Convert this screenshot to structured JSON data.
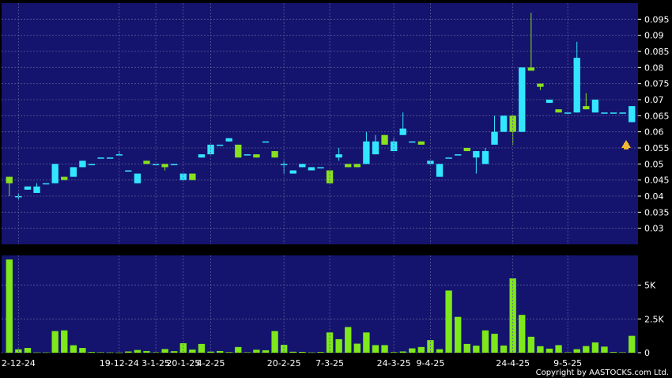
{
  "colors": {
    "background": "#000000",
    "panel": "#14146e",
    "grid": "#5a5a9a",
    "up": "#33e6ff",
    "down": "#88e01e",
    "volume": "#7ee81a",
    "text": "#ffffff",
    "arrow": "#f5b731"
  },
  "copyright": "Copyright by AASTOCKS.com Ltd.",
  "chart_data": [
    {
      "type": "candlestick",
      "y_range": [
        0.025,
        0.1
      ],
      "y_ticks": [
        "0.095",
        "0.09",
        "0.085",
        "0.08",
        "0.075",
        "0.07",
        "0.065",
        "0.06",
        "0.055",
        "0.05",
        "0.045",
        "0.04",
        "0.035",
        "0.03"
      ],
      "tick_values": [
        0.095,
        0.09,
        0.085,
        0.08,
        0.075,
        0.07,
        0.065,
        0.06,
        0.055,
        0.05,
        0.045,
        0.04,
        0.035,
        0.03
      ],
      "grid": true,
      "ohlc": [
        [
          0.046,
          0.046,
          0.04,
          0.044
        ],
        [
          0.04,
          0.041,
          0.039,
          0.04
        ],
        [
          0.042,
          0.043,
          0.042,
          0.043
        ],
        [
          0.041,
          0.044,
          0.041,
          0.043
        ],
        [
          0.044,
          0.044,
          0.044,
          0.044
        ],
        [
          0.044,
          0.05,
          0.044,
          0.05
        ],
        [
          0.046,
          0.046,
          0.045,
          0.045
        ],
        [
          0.046,
          0.049,
          0.046,
          0.049
        ],
        [
          0.049,
          0.051,
          0.049,
          0.051
        ],
        [
          0.05,
          0.05,
          0.05,
          0.05
        ],
        [
          0.052,
          0.052,
          0.052,
          0.052
        ],
        [
          0.052,
          0.052,
          0.052,
          0.052
        ],
        [
          0.053,
          0.054,
          0.053,
          0.053
        ],
        [
          0.048,
          0.048,
          0.048,
          0.048
        ],
        [
          0.044,
          0.047,
          0.044,
          0.047
        ],
        [
          0.051,
          0.051,
          0.05,
          0.05
        ],
        [
          0.05,
          0.05,
          0.05,
          0.05
        ],
        [
          0.05,
          0.05,
          0.048,
          0.049
        ],
        [
          0.05,
          0.05,
          0.05,
          0.05
        ],
        [
          0.045,
          0.047,
          0.045,
          0.047
        ],
        [
          0.047,
          0.047,
          0.045,
          0.045
        ],
        [
          0.052,
          0.053,
          0.052,
          0.053
        ],
        [
          0.053,
          0.056,
          0.053,
          0.056
        ],
        [
          0.056,
          0.056,
          0.056,
          0.056
        ],
        [
          0.057,
          0.058,
          0.057,
          0.058
        ],
        [
          0.056,
          0.056,
          0.052,
          0.052
        ],
        [
          0.053,
          0.053,
          0.053,
          0.053
        ],
        [
          0.053,
          0.053,
          0.052,
          0.052
        ],
        [
          0.057,
          0.057,
          0.057,
          0.057
        ],
        [
          0.054,
          0.054,
          0.052,
          0.052
        ],
        [
          0.05,
          0.051,
          0.047,
          0.05
        ],
        [
          0.047,
          0.048,
          0.047,
          0.048
        ],
        [
          0.049,
          0.05,
          0.049,
          0.05
        ],
        [
          0.048,
          0.049,
          0.048,
          0.049
        ],
        [
          0.049,
          0.049,
          0.049,
          0.049
        ],
        [
          0.048,
          0.048,
          0.044,
          0.044
        ],
        [
          0.052,
          0.055,
          0.051,
          0.053
        ],
        [
          0.05,
          0.05,
          0.049,
          0.049
        ],
        [
          0.05,
          0.05,
          0.049,
          0.049
        ],
        [
          0.05,
          0.06,
          0.05,
          0.057
        ],
        [
          0.053,
          0.059,
          0.053,
          0.057
        ],
        [
          0.059,
          0.059,
          0.056,
          0.056
        ],
        [
          0.054,
          0.058,
          0.054,
          0.057
        ],
        [
          0.059,
          0.066,
          0.059,
          0.061
        ],
        [
          0.057,
          0.057,
          0.057,
          0.057
        ],
        [
          0.057,
          0.057,
          0.056,
          0.056
        ],
        [
          0.05,
          0.05,
          0.05,
          0.051
        ],
        [
          0.046,
          0.05,
          0.046,
          0.05
        ],
        [
          0.052,
          0.052,
          0.052,
          0.052
        ],
        [
          0.053,
          0.053,
          0.053,
          0.053
        ],
        [
          0.055,
          0.055,
          0.054,
          0.054
        ],
        [
          0.052,
          0.054,
          0.047,
          0.054
        ],
        [
          0.05,
          0.055,
          0.05,
          0.054
        ],
        [
          0.056,
          0.065,
          0.056,
          0.06
        ],
        [
          0.06,
          0.065,
          0.06,
          0.065
        ],
        [
          0.065,
          0.065,
          0.056,
          0.06
        ],
        [
          0.06,
          0.08,
          0.06,
          0.08
        ],
        [
          0.08,
          0.097,
          0.079,
          0.079
        ],
        [
          0.075,
          0.075,
          0.073,
          0.074
        ],
        [
          0.069,
          0.07,
          0.069,
          0.07
        ],
        [
          0.067,
          0.067,
          0.066,
          0.066
        ],
        [
          0.066,
          0.066,
          0.066,
          0.066
        ],
        [
          0.066,
          0.088,
          0.066,
          0.083
        ],
        [
          0.068,
          0.072,
          0.067,
          0.067
        ],
        [
          0.066,
          0.07,
          0.066,
          0.07
        ],
        [
          0.066,
          0.066,
          0.066,
          0.066
        ],
        [
          0.066,
          0.066,
          0.066,
          0.066
        ],
        [
          0.066,
          0.066,
          0.066,
          0.066
        ],
        [
          0.063,
          0.068,
          0.063,
          0.068
        ]
      ]
    },
    {
      "type": "bar",
      "y_range": [
        0,
        7200
      ],
      "y_ticks": [
        "5K",
        "2.5K",
        "0"
      ],
      "tick_values": [
        5000,
        2500,
        0
      ],
      "grid": true,
      "values": [
        6900,
        250,
        350,
        20,
        20,
        1600,
        1650,
        550,
        350,
        50,
        30,
        20,
        10,
        90,
        200,
        120,
        30,
        270,
        110,
        700,
        230,
        650,
        80,
        120,
        40,
        420,
        30,
        220,
        180,
        1600,
        580,
        70,
        60,
        20,
        50,
        1500,
        1000,
        1900,
        670,
        1500,
        560,
        560,
        40,
        90,
        320,
        420,
        930,
        260,
        4600,
        2650,
        650,
        520,
        1650,
        1400,
        530,
        5500,
        2800,
        1180,
        480,
        300,
        560,
        30,
        260,
        490,
        760,
        450,
        50,
        30,
        1250
      ],
      "x_tick_labels": [
        "2-12-24",
        "19-12-24",
        "3-1-25",
        "20-1-25",
        "4-2-25",
        "20-2-25",
        "7-3-25",
        "24-3-25",
        "9-4-25",
        "24-4-25",
        "9-5-25"
      ],
      "x_tick_bars": [
        1,
        12,
        16,
        19,
        22,
        30,
        35,
        42,
        46,
        55,
        61
      ]
    }
  ]
}
